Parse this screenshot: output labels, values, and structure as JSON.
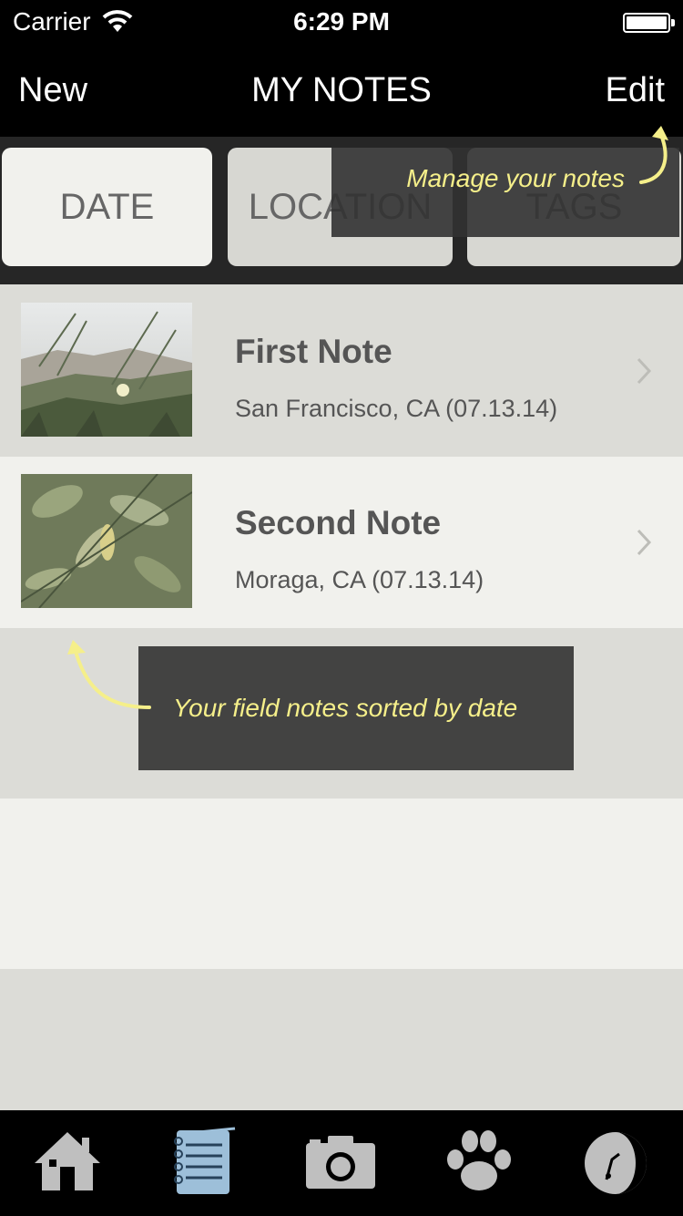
{
  "status_bar": {
    "carrier": "Carrier",
    "time": "6:29 PM"
  },
  "nav": {
    "left_button": "New",
    "title": "MY NOTES",
    "right_button": "Edit"
  },
  "segments": [
    {
      "label": "DATE",
      "selected": true
    },
    {
      "label": "LOCATION",
      "selected": false
    },
    {
      "label": "TAGS",
      "selected": false
    }
  ],
  "notes": [
    {
      "title": "First Note",
      "subtitle": "San Francisco, CA (07.13.14)"
    },
    {
      "title": "Second Note",
      "subtitle": "Moraga, CA (07.13.14)"
    }
  ],
  "tips": {
    "manage": "Manage your notes",
    "sorted": "Your field notes sorted by date"
  },
  "tab_bar": {
    "items": [
      "home-icon",
      "notebook-icon",
      "camera-icon",
      "paw-icon",
      "compass-icon"
    ],
    "selected": "notebook-icon"
  },
  "colors": {
    "tip_text": "#f5ef8a",
    "active_tab": "#9dbfd9"
  }
}
